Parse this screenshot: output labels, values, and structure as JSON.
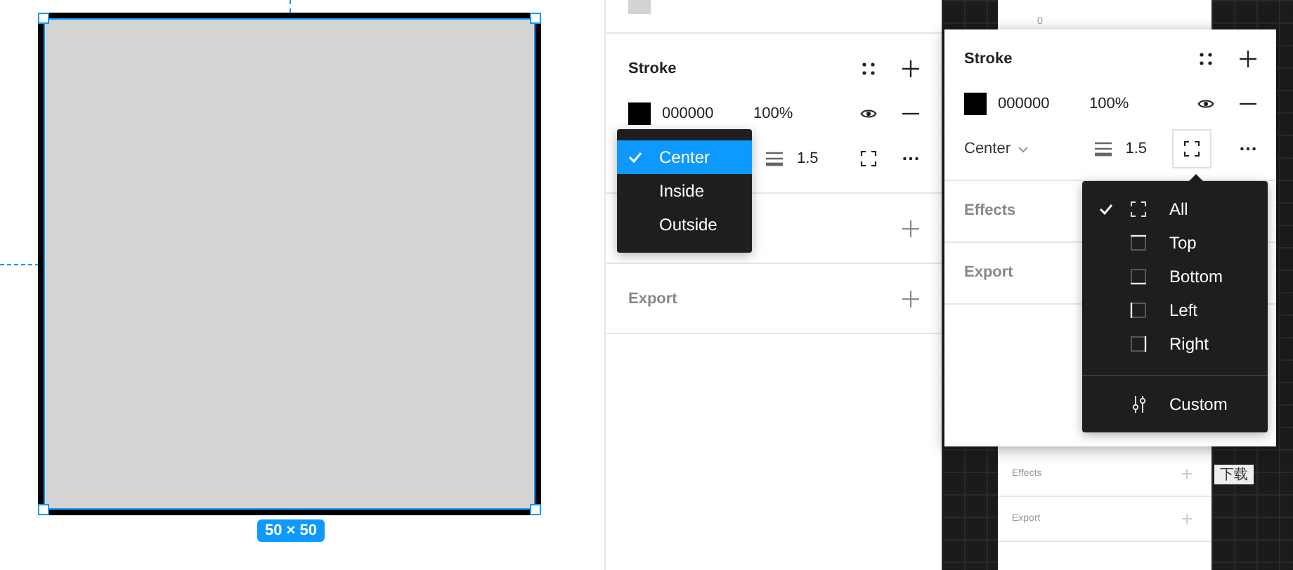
{
  "canvas": {
    "size_label": "50 × 50"
  },
  "left_panel": {
    "stroke": {
      "title": "Stroke",
      "color_hex": "000000",
      "opacity": "100%",
      "weight": "1.5"
    },
    "align_menu": [
      {
        "label": "Center",
        "selected": true
      },
      {
        "label": "Inside",
        "selected": false
      },
      {
        "label": "Outside",
        "selected": false
      }
    ],
    "export_title": "Export"
  },
  "right_panel": {
    "background": {
      "value": "0",
      "effects": "Effects",
      "export": "Export",
      "side_label": "下载"
    },
    "stroke": {
      "title": "Stroke",
      "color_hex": "000000",
      "opacity": "100%",
      "align": "Center",
      "weight": "1.5"
    },
    "sections": [
      "Effects",
      "Export"
    ],
    "sides_menu": [
      {
        "label": "All",
        "kind": "all",
        "selected": true
      },
      {
        "label": "Top",
        "kind": "top",
        "selected": false
      },
      {
        "label": "Bottom",
        "kind": "bottom",
        "selected": false
      },
      {
        "label": "Left",
        "kind": "left",
        "selected": false
      },
      {
        "label": "Right",
        "kind": "right",
        "selected": false
      },
      {
        "label": "Custom",
        "kind": "custom",
        "selected": false
      }
    ]
  }
}
